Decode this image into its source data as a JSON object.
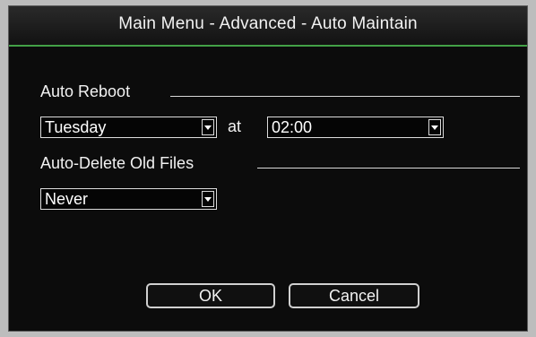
{
  "window": {
    "title": "Main Menu - Advanced - Auto Maintain"
  },
  "auto_reboot": {
    "label": "Auto Reboot",
    "day_value": "Tuesday",
    "at_label": "at",
    "time_value": "02:00"
  },
  "auto_delete": {
    "label": "Auto-Delete Old Files",
    "value": "Never"
  },
  "buttons": {
    "ok_label": "OK",
    "cancel_label": "Cancel"
  },
  "colors": {
    "accent": "#43a047",
    "background": "#0c0c0c",
    "text": "#f2f2f2"
  },
  "icons": {
    "dropdown": "chevron-down-icon"
  }
}
